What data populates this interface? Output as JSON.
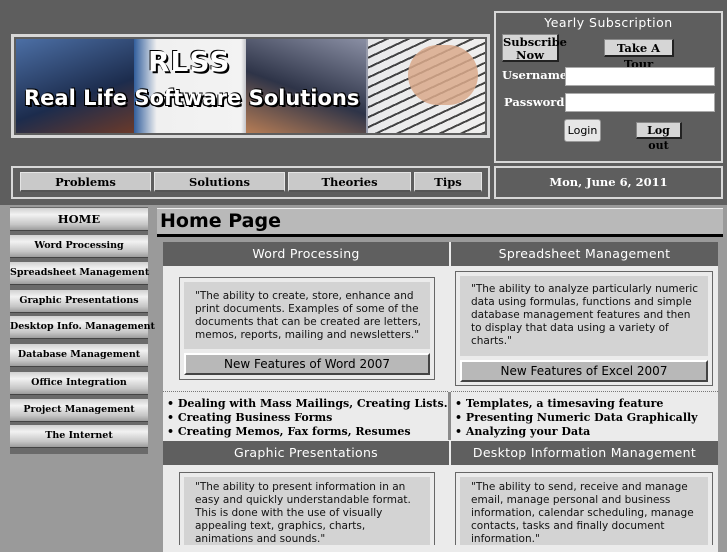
{
  "banner": {
    "logo": "RLSS",
    "tagline": "Real Life Software Solutions"
  },
  "subscription": {
    "title": "Yearly Subscription",
    "subscribe_label": "Subscribe Now",
    "tour_label": "Take A Tour",
    "username_label": "Username",
    "password_label": "Password",
    "username_value": "",
    "password_value": "",
    "login_label": "Login",
    "logout_label": "Log out"
  },
  "nav": [
    "Problems",
    "Solutions",
    "Theories",
    "Tips"
  ],
  "date": "Mon, June 6, 2011",
  "sidebar": [
    "HOME",
    "Word Processing",
    "Spreadsheet Management",
    "Graphic Presentations",
    "Desktop Info. Management",
    "Database Management",
    "Office Integration",
    "Project Management",
    "The Internet"
  ],
  "page_title": "Home Page",
  "sections": {
    "word": {
      "title": "Word Processing",
      "quote": "\"The ability to create, store, enhance and print documents. Examples of some of the documents that can be created are letters, memos, reports, mailing and newsletters.\"",
      "button": "New Features of Word 2007",
      "bullets": [
        "Dealing with Mass Mailings, Creating Lists.",
        "Creating Business Forms",
        "Creating Memos, Fax forms, Resumes"
      ]
    },
    "spreadsheet": {
      "title": "Spreadsheet Management",
      "quote": "\"The ability to analyze particularly numeric data using formulas, functions and simple database management features and then to display that data using a variety of charts.\"",
      "button": "New Features of Excel 2007",
      "bullets": [
        "Templates, a timesaving feature",
        "Presenting Numeric Data Graphically",
        "Analyzing your Data"
      ]
    },
    "graphic": {
      "title": "Graphic Presentations",
      "quote": "\"The ability to present information in an easy and quickly understandable format. This is done with the use of visually appealing text, graphics, charts, animations and sounds.\""
    },
    "desktop": {
      "title": "Desktop Information Management",
      "quote": "\"The ability to send, receive and manage email, manage personal and business information, calendar scheduling, manage contacts, tasks and finally document information.\""
    }
  }
}
